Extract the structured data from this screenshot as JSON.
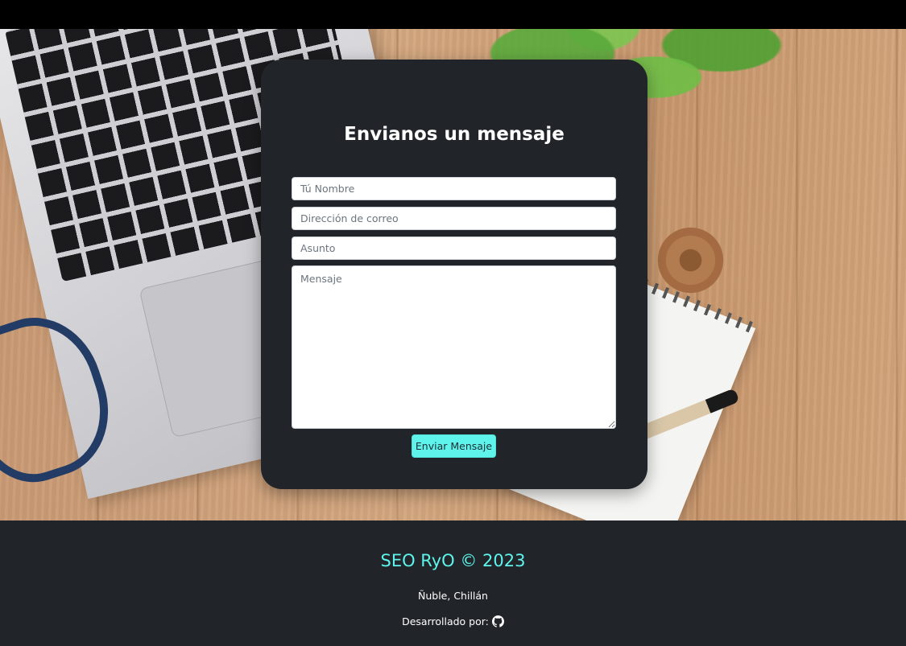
{
  "form": {
    "title": "Envianos un mensaje",
    "name_placeholder": "Tú Nombre",
    "email_placeholder": "Dirección de correo",
    "subject_placeholder": "Asunto",
    "message_placeholder": "Mensaje",
    "submit_label": "Enviar Mensaje"
  },
  "footer": {
    "brand": "SEO RyO © 2023",
    "location": "Ñuble, Chillán",
    "developed_by": "Desarrollado por:",
    "github_icon": "github-icon"
  },
  "colors": {
    "accent": "#5ef4ec",
    "card_bg": "#212529",
    "footer_bg": "#212529"
  }
}
